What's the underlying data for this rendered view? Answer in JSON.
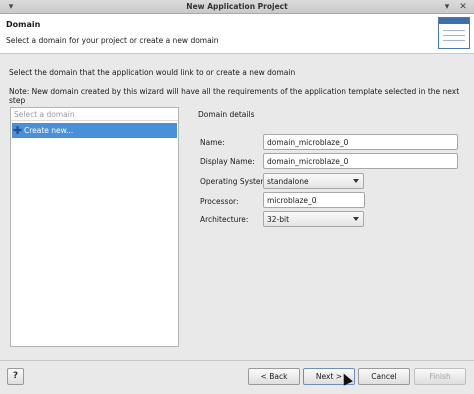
{
  "window": {
    "title": "New Application Project"
  },
  "header": {
    "title": "Domain",
    "description": "Select a domain for your project or create a new domain"
  },
  "intro_text": "Select the domain that the application would link to or create a new domain",
  "note_text": "Note: New domain created by this wizard will have all the requirements of the application template selected in the next step",
  "domain_list": {
    "header": "Select a domain",
    "items": [
      {
        "label": "Create new...",
        "selected": true
      }
    ]
  },
  "domain_details": {
    "title": "Domain details",
    "name_label": "Name:",
    "name_value": "domain_microblaze_0",
    "display_name_label": "Display Name:",
    "display_name_value": "domain_microblaze_0",
    "os_label": "Operating System:",
    "os_value": "standalone",
    "processor_label": "Processor:",
    "processor_value": "microblaze_0",
    "architecture_label": "Architecture:",
    "architecture_value": "32-bit"
  },
  "footer": {
    "help_label": "?",
    "back_label": "< Back",
    "next_label": "Next >",
    "cancel_label": "Cancel",
    "finish_label": "Finish"
  }
}
